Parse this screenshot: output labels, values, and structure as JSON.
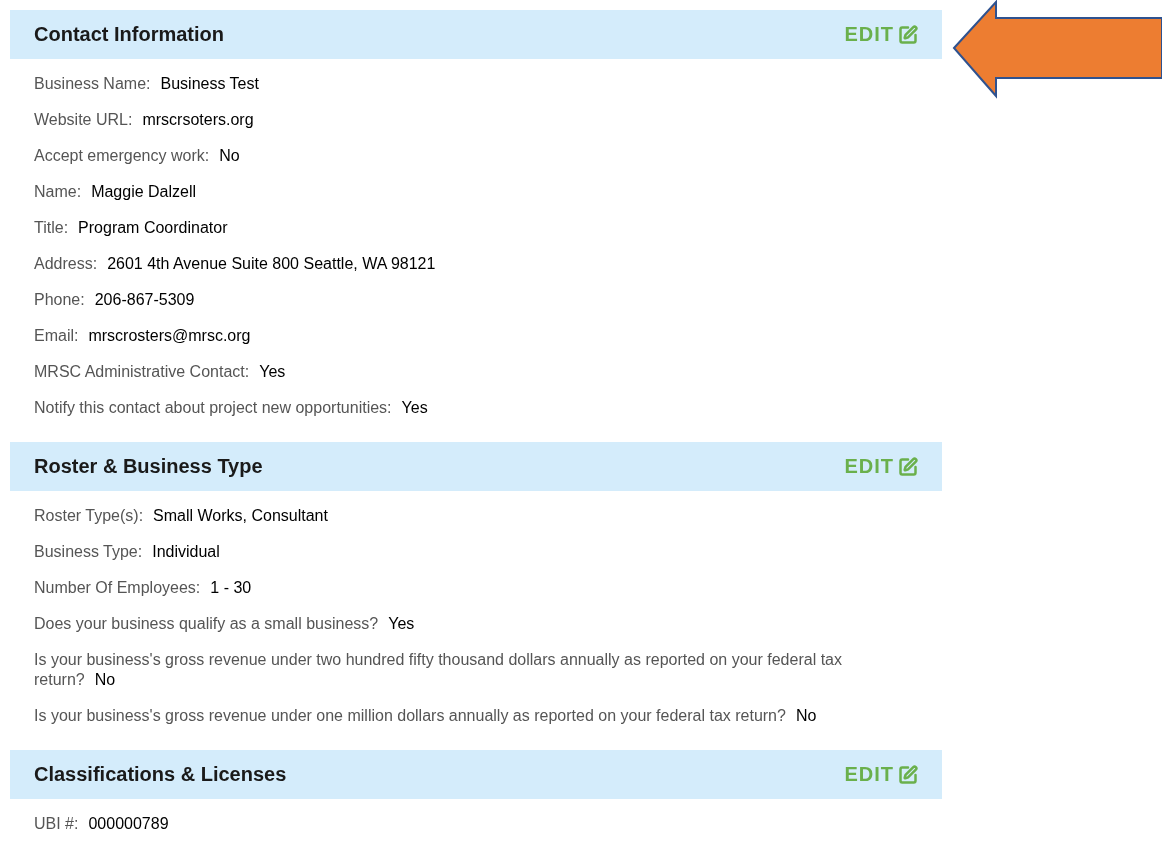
{
  "sections": [
    {
      "title": "Contact Information",
      "edit": "EDIT",
      "rows": [
        {
          "label": "Business Name:",
          "value": "Business Test"
        },
        {
          "label": "Website URL:",
          "value": "mrscrsoters.org"
        },
        {
          "label": "Accept emergency work:",
          "value": "No"
        },
        {
          "label": "Name:",
          "value": "Maggie Dalzell"
        },
        {
          "label": "Title:",
          "value": "Program Coordinator"
        },
        {
          "label": "Address:",
          "value": "2601 4th Avenue Suite 800 Seattle, WA 98121"
        },
        {
          "label": "Phone:",
          "value": "206-867-5309"
        },
        {
          "label": "Email:",
          "value": "mrscrosters@mrsc.org"
        },
        {
          "label": "MRSC Administrative Contact:",
          "value": "Yes"
        },
        {
          "label": "Notify this contact about project new opportunities:",
          "value": "Yes"
        }
      ]
    },
    {
      "title": "Roster & Business Type",
      "edit": "EDIT",
      "rows": [
        {
          "label": "Roster Type(s):",
          "value": "Small Works, Consultant"
        },
        {
          "label": "Business Type:",
          "value": "Individual"
        },
        {
          "label": "Number Of Employees:",
          "value": "1 - 30"
        },
        {
          "label": "Does your business qualify as a small business?",
          "value": "Yes"
        },
        {
          "label": "Is your business's gross revenue under two hundred fifty thousand dollars annually as reported on your federal tax return?",
          "value": "No"
        },
        {
          "label": "Is your business's gross revenue under one million dollars annually as reported on your federal tax return?",
          "value": "No"
        }
      ]
    },
    {
      "title": "Classifications & Licenses",
      "edit": "EDIT",
      "rows": [
        {
          "label": "UBI #:",
          "value": "000000789"
        }
      ]
    }
  ]
}
